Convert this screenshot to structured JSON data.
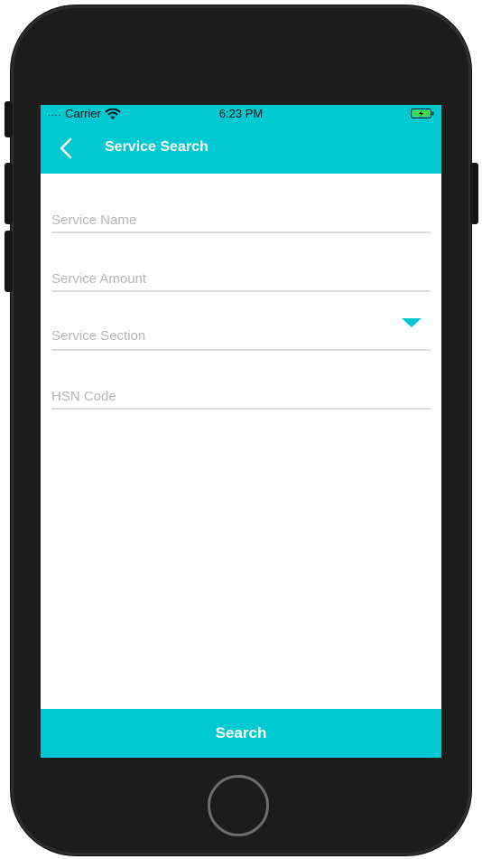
{
  "statusbar": {
    "signal": "....",
    "carrier": "Carrier",
    "time": "6:23 PM",
    "wifi_icon": "wifi-icon",
    "battery_icon": "battery-charging-icon"
  },
  "navbar": {
    "back_icon": "chevron-left-icon",
    "title": "Service Search"
  },
  "form": {
    "service_name": {
      "placeholder": "Service Name",
      "value": ""
    },
    "service_amount": {
      "placeholder": "Service Amount",
      "value": ""
    },
    "service_section": {
      "placeholder": "Service Section",
      "dropdown_icon": "triangle-down-icon"
    },
    "hsn_code": {
      "placeholder": "HSN Code",
      "value": ""
    }
  },
  "actions": {
    "search_label": "Search"
  },
  "colors": {
    "accent": "#00c9d1",
    "divider": "#dcdcdc",
    "placeholder": "#b5b5b5",
    "device_body": "#1c1c1c"
  }
}
